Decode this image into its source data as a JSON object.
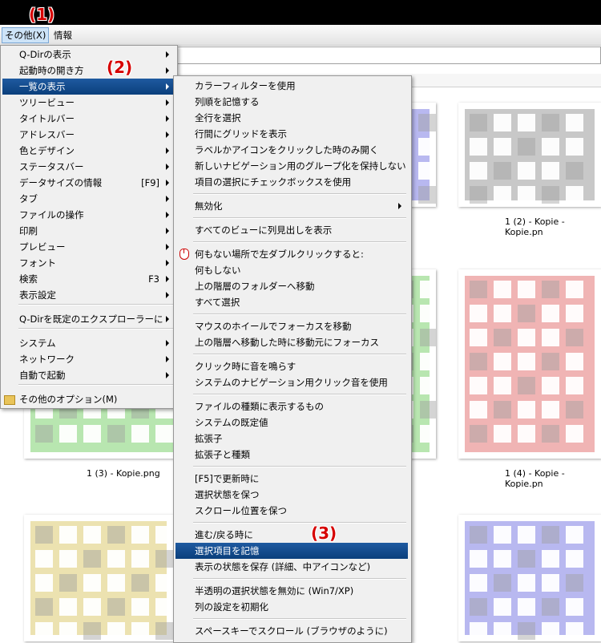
{
  "menubar": {
    "items": [
      {
        "label": "その他(X)"
      },
      {
        "label": "情報"
      }
    ]
  },
  "annotations": [
    "(1)",
    "(2)",
    "(3)"
  ],
  "thumbnails": {
    "captions": [
      "1 (2) - Kopie - Kopie.pn",
      "1 (3) - Kopie.png",
      "1 (4) - Kopie - Kopie.pn"
    ],
    "colors": {
      "gray": "#c8c8c8",
      "green": "#b8e6b0",
      "red": "#f0b4b4",
      "yellow": "#ece2b0",
      "blue": "#b8b8f0",
      "dark": "#a0a0a0"
    }
  },
  "main_menu": {
    "items": [
      {
        "label": "Q-Dirの表示",
        "submenu": true
      },
      {
        "label": "起動時の開き方",
        "submenu": true
      },
      {
        "label": "一覧の表示",
        "submenu": true,
        "highlighted": true
      },
      {
        "label": "ツリービュー",
        "submenu": true
      },
      {
        "label": "タイトルバー",
        "submenu": true
      },
      {
        "label": "アドレスバー",
        "submenu": true
      },
      {
        "label": "色とデザイン",
        "submenu": true
      },
      {
        "label": "ステータスバー",
        "submenu": true
      },
      {
        "label": "データサイズの情報",
        "shortcut": "[F9]",
        "submenu": true
      },
      {
        "label": "タブ",
        "submenu": true
      },
      {
        "label": "ファイルの操作",
        "submenu": true
      },
      {
        "label": "印刷",
        "submenu": true
      },
      {
        "label": "プレビュー",
        "submenu": true
      },
      {
        "label": "フォント",
        "submenu": true
      },
      {
        "label": "検索",
        "shortcut": "F3",
        "submenu": true
      },
      {
        "label": "表示設定",
        "submenu": true
      },
      {
        "label": "Q-Dirを既定のエクスプローラーに",
        "submenu": true
      },
      {
        "label": "システム",
        "submenu": true
      },
      {
        "label": "ネットワーク",
        "submenu": true
      },
      {
        "label": "自動で起動",
        "submenu": true
      },
      {
        "label": "その他のオプション(M)",
        "icon": "folder-icon"
      }
    ]
  },
  "sub_menu": {
    "items": [
      {
        "label": "カラーフィルターを使用"
      },
      {
        "label": "列順を記憶する"
      },
      {
        "label": "全行を選択"
      },
      {
        "label": "行間にグリッドを表示"
      },
      {
        "label": "ラベルかアイコンをクリックした時のみ開く"
      },
      {
        "label": "新しいナビゲーション用のグループ化を保持しない"
      },
      {
        "label": "項目の選択にチェックボックスを使用"
      },
      {
        "label": "無効化",
        "submenu": true
      },
      {
        "label": "すべてのビューに列見出しを表示"
      },
      {
        "label": "何もない場所で左ダブルクリックすると:",
        "icon": "mouse-icon"
      },
      {
        "label": "何もしない"
      },
      {
        "label": "上の階層のフォルダーへ移動"
      },
      {
        "label": "すべて選択"
      },
      {
        "label": "マウスのホイールでフォーカスを移動"
      },
      {
        "label": "上の階層へ移動した時に移動元にフォーカス"
      },
      {
        "label": "クリック時に音を鳴らす"
      },
      {
        "label": "システムのナビゲーション用クリック音を使用"
      },
      {
        "label": "ファイルの種類に表示するもの"
      },
      {
        "label": "システムの既定値"
      },
      {
        "label": "拡張子"
      },
      {
        "label": "拡張子と種類"
      },
      {
        "label": "[F5]で更新時に"
      },
      {
        "label": "選択状態を保つ"
      },
      {
        "label": "スクロール位置を保つ"
      },
      {
        "label": "進む/戻る時に"
      },
      {
        "label": "選択項目を記憶",
        "highlighted": true
      },
      {
        "label": "表示の状態を保存 (詳細、中アイコンなど)"
      },
      {
        "label": "半透明の選択状態を無効に (Win7/XP)"
      },
      {
        "label": "列の設定を初期化"
      },
      {
        "label": "スペースキーでスクロール (ブラウザのように)"
      }
    ]
  }
}
